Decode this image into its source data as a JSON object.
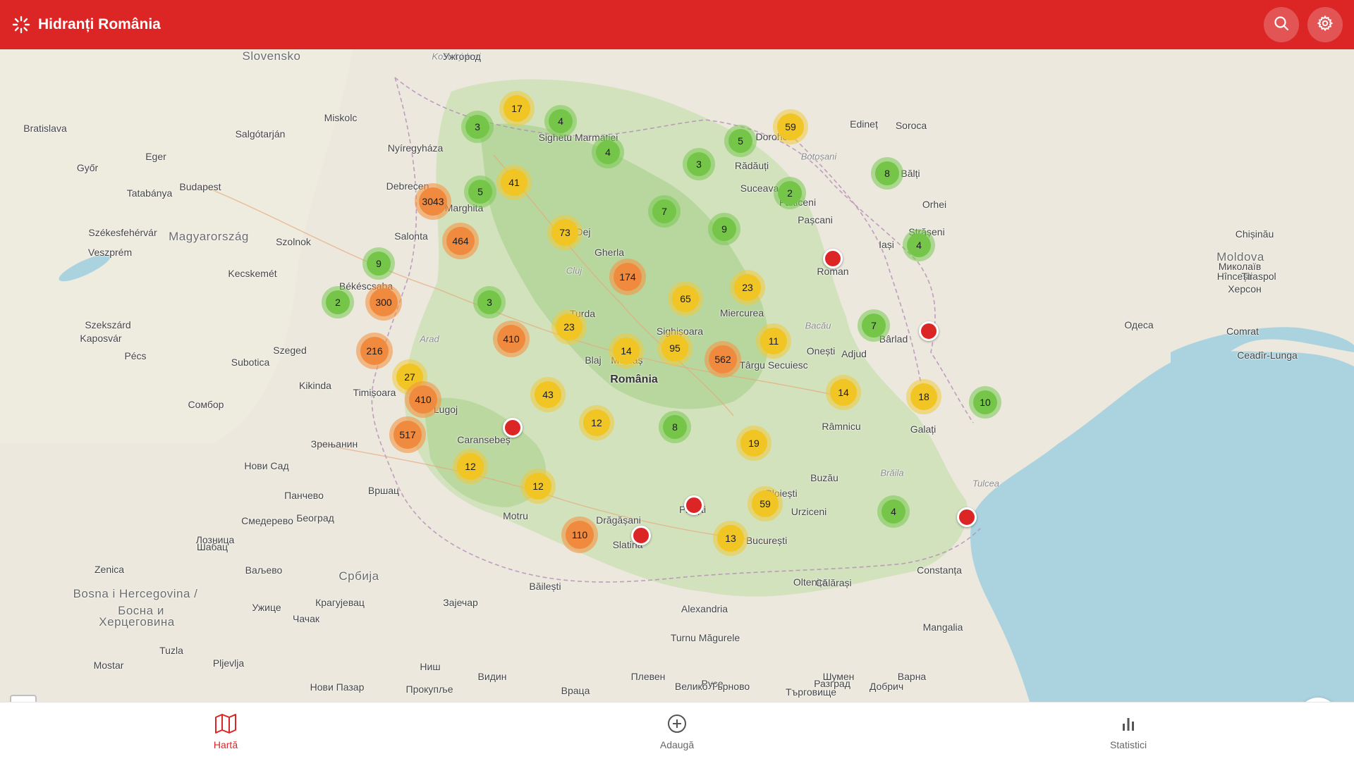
{
  "header": {
    "title": "Hidranți România"
  },
  "nav": [
    {
      "label": "Hartă",
      "icon": "map-icon",
      "active": true
    },
    {
      "label": "Adaugă",
      "icon": "plus-circle-icon",
      "active": false
    },
    {
      "label": "Statistici",
      "icon": "bar-chart-icon",
      "active": false
    }
  ],
  "map": {
    "zoom_in": "+",
    "zoom_out": "−",
    "places": [
      {
        "t": "Slovensko",
        "c": "country"
      },
      {
        "t": "Košický kraj",
        "c": "region"
      },
      {
        "t": "Ужгород",
        "c": ""
      },
      {
        "t": "Bratislava",
        "c": ""
      },
      {
        "t": "Magyarország",
        "c": "country"
      },
      {
        "t": "Budapest",
        "c": ""
      },
      {
        "t": "Miskolc",
        "c": ""
      },
      {
        "t": "Debrecen",
        "c": ""
      },
      {
        "t": "Szeged",
        "c": ""
      },
      {
        "t": "Szolnok",
        "c": ""
      },
      {
        "t": "Kecskemét",
        "c": ""
      },
      {
        "t": "Pécs",
        "c": ""
      },
      {
        "t": "Győr",
        "c": ""
      },
      {
        "t": "Veszprém",
        "c": ""
      },
      {
        "t": "Székesfehérvár",
        "c": ""
      },
      {
        "t": "România",
        "c": "big"
      },
      {
        "t": "Moldova",
        "c": "country"
      },
      {
        "t": "Chișinău",
        "c": ""
      },
      {
        "t": "Hîncești",
        "c": ""
      },
      {
        "t": "Tiraspol",
        "c": ""
      },
      {
        "t": "Comrat",
        "c": ""
      },
      {
        "t": "Ceadîr-Lunga",
        "c": ""
      },
      {
        "t": "Одеса",
        "c": ""
      },
      {
        "t": "Миколаїв",
        "c": ""
      },
      {
        "t": "Херсон",
        "c": ""
      },
      {
        "t": "Србија",
        "c": "country"
      },
      {
        "t": "Београд",
        "c": ""
      },
      {
        "t": "Нови Сад",
        "c": ""
      },
      {
        "t": "Bosna i Hercegovina /",
        "c": "country"
      },
      {
        "t": "Босна и",
        "c": "country"
      },
      {
        "t": "Херцеговина",
        "c": "country"
      },
      {
        "t": "Timișoara",
        "c": ""
      },
      {
        "t": "Arad",
        "c": "region"
      },
      {
        "t": "Cluj",
        "c": "region"
      },
      {
        "t": "Iași",
        "c": ""
      },
      {
        "t": "Galați",
        "c": ""
      },
      {
        "t": "Brăila",
        "c": "region"
      },
      {
        "t": "Ploiești",
        "c": ""
      },
      {
        "t": "București",
        "c": ""
      },
      {
        "t": "Constanța",
        "c": ""
      },
      {
        "t": "Mangalia",
        "c": ""
      },
      {
        "t": "Tulcea",
        "c": "region"
      },
      {
        "t": "Pitești",
        "c": ""
      },
      {
        "t": "Slatina",
        "c": ""
      },
      {
        "t": "Drăgășani",
        "c": ""
      },
      {
        "t": "Alexandria",
        "c": ""
      },
      {
        "t": "Bacău",
        "c": "region"
      },
      {
        "t": "Roman",
        "c": ""
      },
      {
        "t": "Onești",
        "c": ""
      },
      {
        "t": "Bârlad",
        "c": ""
      },
      {
        "t": "Suceava",
        "c": ""
      },
      {
        "t": "Dorohoi",
        "c": ""
      },
      {
        "t": "Botoșani",
        "c": "region"
      },
      {
        "t": "Sighișoara",
        "c": ""
      },
      {
        "t": "Mediaș",
        "c": ""
      },
      {
        "t": "Blaj",
        "c": ""
      },
      {
        "t": "Turda",
        "c": ""
      },
      {
        "t": "Dej",
        "c": ""
      },
      {
        "t": "Gherla",
        "c": ""
      },
      {
        "t": "Miercurea",
        "c": ""
      },
      {
        "t": "Târgu Secuiesc",
        "c": ""
      },
      {
        "t": "Caransebeș",
        "c": ""
      },
      {
        "t": "Lugoj",
        "c": ""
      },
      {
        "t": "Motru",
        "c": ""
      },
      {
        "t": "Băilești",
        "c": ""
      },
      {
        "t": "Видин",
        "c": ""
      },
      {
        "t": "Враца",
        "c": ""
      },
      {
        "t": "Плевен",
        "c": ""
      },
      {
        "t": "Русе",
        "c": ""
      },
      {
        "t": "Добрич",
        "c": ""
      },
      {
        "t": "Варна",
        "c": ""
      },
      {
        "t": "Шумен",
        "c": ""
      },
      {
        "t": "Разград",
        "c": ""
      },
      {
        "t": "Велико Търново",
        "c": ""
      },
      {
        "t": "Търговище",
        "c": ""
      },
      {
        "t": "Зајечар",
        "c": ""
      },
      {
        "t": "Ниш",
        "c": ""
      },
      {
        "t": "Нови Пазар",
        "c": ""
      },
      {
        "t": "Прокупље",
        "c": ""
      },
      {
        "t": "Крагујевац",
        "c": ""
      },
      {
        "t": "Чачак",
        "c": ""
      },
      {
        "t": "Ужице",
        "c": ""
      },
      {
        "t": "Ваљево",
        "c": ""
      },
      {
        "t": "Zenica",
        "c": ""
      },
      {
        "t": "Mostar",
        "c": ""
      },
      {
        "t": "Tuzla",
        "c": ""
      },
      {
        "t": "Pljevlja",
        "c": ""
      },
      {
        "t": "Subotica",
        "c": ""
      },
      {
        "t": "Сомбор",
        "c": ""
      },
      {
        "t": "Зрењанин",
        "c": ""
      },
      {
        "t": "Панчево",
        "c": ""
      },
      {
        "t": "Смедерево",
        "c": ""
      },
      {
        "t": "Шабац",
        "c": ""
      },
      {
        "t": "Лозница",
        "c": ""
      },
      {
        "t": "Вршац",
        "c": ""
      },
      {
        "t": "Marghita",
        "c": ""
      },
      {
        "t": "Salonta",
        "c": ""
      },
      {
        "t": "Békéscsaba",
        "c": ""
      },
      {
        "t": "Kikinda",
        "c": ""
      },
      {
        "t": "Kaposvár",
        "c": ""
      },
      {
        "t": "Szekszárd",
        "c": ""
      },
      {
        "t": "Tatabánya",
        "c": ""
      },
      {
        "t": "Salgótarján",
        "c": ""
      },
      {
        "t": "Eger",
        "c": ""
      },
      {
        "t": "Nyíregyháza",
        "c": ""
      },
      {
        "t": "Sighetu Marmației",
        "c": ""
      },
      {
        "t": "Rădăuți",
        "c": ""
      },
      {
        "t": "Fălticeni",
        "c": ""
      },
      {
        "t": "Pașcani",
        "c": ""
      },
      {
        "t": "Edineț",
        "c": ""
      },
      {
        "t": "Soroca",
        "c": ""
      },
      {
        "t": "Bălți",
        "c": ""
      },
      {
        "t": "Orhei",
        "c": ""
      },
      {
        "t": "Strășeni",
        "c": ""
      },
      {
        "t": "Buzău",
        "c": ""
      },
      {
        "t": "Urziceni",
        "c": ""
      },
      {
        "t": "Oltenița",
        "c": ""
      },
      {
        "t": "Călărași",
        "c": ""
      },
      {
        "t": "Turnu Măgurele",
        "c": ""
      },
      {
        "t": "Adjud",
        "c": ""
      },
      {
        "t": "Râmnicu",
        "c": ""
      }
    ],
    "clusters": [
      {
        "n": "17",
        "c": "yellow"
      },
      {
        "n": "3",
        "c": "green"
      },
      {
        "n": "4",
        "c": "green"
      },
      {
        "n": "4",
        "c": "green"
      },
      {
        "n": "41",
        "c": "yellow"
      },
      {
        "n": "5",
        "c": "green"
      },
      {
        "n": "3043",
        "c": "orange"
      },
      {
        "n": "464",
        "c": "orange"
      },
      {
        "n": "73",
        "c": "yellow"
      },
      {
        "n": "7",
        "c": "green"
      },
      {
        "n": "3",
        "c": "green"
      },
      {
        "n": "5",
        "c": "green"
      },
      {
        "n": "59",
        "c": "yellow"
      },
      {
        "n": "8",
        "c": "green"
      },
      {
        "n": "2",
        "c": "green"
      },
      {
        "n": "9",
        "c": "green"
      },
      {
        "n": "4",
        "c": "green"
      },
      {
        "n": "9",
        "c": "green"
      },
      {
        "n": "174",
        "c": "orange"
      },
      {
        "n": "23",
        "c": "yellow"
      },
      {
        "n": "65",
        "c": "yellow"
      },
      {
        "n": "2",
        "c": "green"
      },
      {
        "n": "300",
        "c": "orange"
      },
      {
        "n": "3",
        "c": "green"
      },
      {
        "n": "23",
        "c": "yellow"
      },
      {
        "n": "410",
        "c": "orange"
      },
      {
        "n": "216",
        "c": "orange"
      },
      {
        "n": "14",
        "c": "yellow"
      },
      {
        "n": "95",
        "c": "yellow"
      },
      {
        "n": "562",
        "c": "orange"
      },
      {
        "n": "11",
        "c": "yellow"
      },
      {
        "n": "7",
        "c": "green"
      },
      {
        "n": "27",
        "c": "yellow"
      },
      {
        "n": "410",
        "c": "orange"
      },
      {
        "n": "43",
        "c": "yellow"
      },
      {
        "n": "12",
        "c": "yellow"
      },
      {
        "n": "8",
        "c": "green"
      },
      {
        "n": "14",
        "c": "yellow"
      },
      {
        "n": "18",
        "c": "yellow"
      },
      {
        "n": "10",
        "c": "green"
      },
      {
        "n": "517",
        "c": "orange"
      },
      {
        "n": "19",
        "c": "yellow"
      },
      {
        "n": "12",
        "c": "yellow"
      },
      {
        "n": "12",
        "c": "yellow"
      },
      {
        "n": "59",
        "c": "yellow"
      },
      {
        "n": "4",
        "c": "green"
      },
      {
        "n": "110",
        "c": "orange"
      },
      {
        "n": "13",
        "c": "yellow"
      }
    ],
    "pins": 8
  },
  "colors": {
    "brand": "#dc2626",
    "cluster_green": "#74c548",
    "cluster_yellow": "#f0c524",
    "cluster_orange": "#f08a3e",
    "sea": "#aad3df"
  }
}
